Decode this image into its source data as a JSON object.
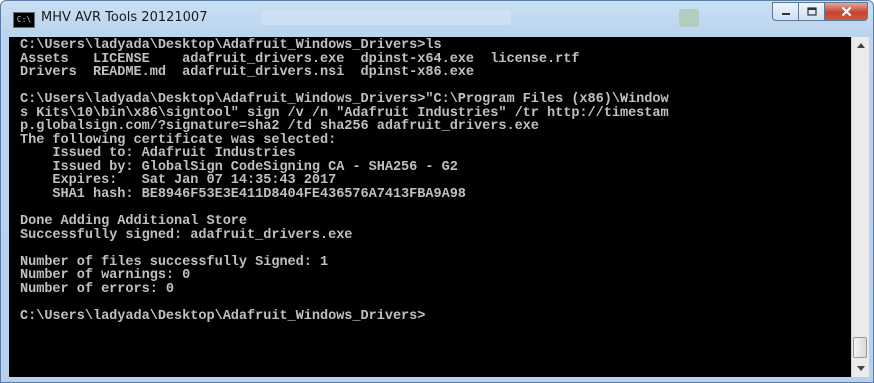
{
  "window": {
    "title": "MHV AVR Tools 20121007",
    "icon_label": "C:\\",
    "icon": "console-icon"
  },
  "caption_buttons": {
    "minimize": "minimize-icon",
    "maximize": "maximize-icon",
    "close": "close-icon"
  },
  "console": {
    "lines": [
      "C:\\Users\\ladyada\\Desktop\\Adafruit_Windows_Drivers>ls",
      "Assets   LICENSE    adafruit_drivers.exe  dpinst-x64.exe  license.rtf",
      "Drivers  README.md  adafruit_drivers.nsi  dpinst-x86.exe",
      "",
      "C:\\Users\\ladyada\\Desktop\\Adafruit_Windows_Drivers>\"C:\\Program Files (x86)\\Window",
      "s Kits\\10\\bin\\x86\\signtool\" sign /v /n \"Adafruit Industries\" /tr http://timestam",
      "p.globalsign.com/?signature=sha2 /td sha256 adafruit_drivers.exe",
      "The following certificate was selected:",
      "    Issued to: Adafruit Industries",
      "    Issued by: GlobalSign CodeSigning CA - SHA256 - G2",
      "    Expires:   Sat Jan 07 14:35:43 2017",
      "    SHA1 hash: BE8946F53E3E411D8404FE436576A7413FBA9A98",
      "",
      "Done Adding Additional Store",
      "Successfully signed: adafruit_drivers.exe",
      "",
      "Number of files successfully Signed: 1",
      "Number of warnings: 0",
      "Number of errors: 0",
      "",
      "C:\\Users\\ladyada\\Desktop\\Adafruit_Windows_Drivers>"
    ]
  },
  "colors": {
    "console_bg": "#000000",
    "console_fg": "#c0c0c0",
    "close_button": "#c7432f",
    "titlebar": "#bcd5ee"
  }
}
